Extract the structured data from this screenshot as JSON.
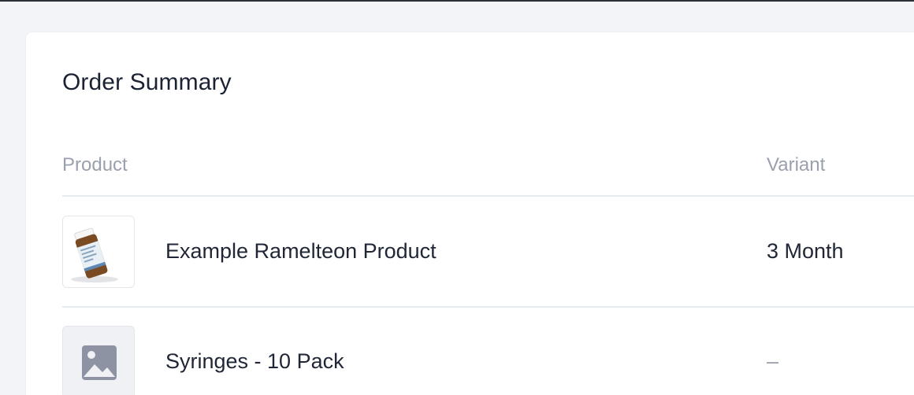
{
  "order_summary": {
    "title": "Order Summary",
    "columns": {
      "product": "Product",
      "variant": "Variant"
    },
    "items": [
      {
        "name": "Example Ramelteon Product",
        "variant": "3 Month",
        "image": "medicine-bottle-image"
      },
      {
        "name": "Syringes - 10 Pack",
        "variant": "–",
        "image": "image-placeholder-icon"
      }
    ]
  },
  "colors": {
    "page_bg": "#f3f4f7",
    "card_bg": "#ffffff",
    "text_primary": "#1f2635",
    "text_muted": "#9aa0ad",
    "divider": "#e6ebef"
  }
}
